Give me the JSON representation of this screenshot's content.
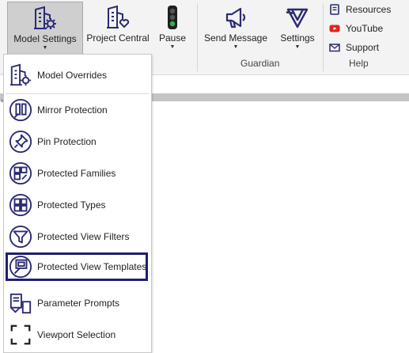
{
  "ribbon": {
    "buttons": [
      {
        "label": "Model Settings",
        "icon": "building-gear-icon",
        "has_dropdown": true
      },
      {
        "label": "Project Central",
        "icon": "building-heart-icon",
        "has_dropdown": false
      },
      {
        "label": "Pause",
        "icon": "traffic-light-icon",
        "has_dropdown": true
      },
      {
        "label": "Send Message",
        "icon": "megaphone-icon",
        "has_dropdown": true
      },
      {
        "label": "Settings",
        "icon": "guardian-logo-icon",
        "has_dropdown": true
      }
    ],
    "groups": {
      "guardian": "Guardian",
      "help": "Help"
    },
    "help_items": [
      {
        "label": "Resources",
        "icon": "book-icon"
      },
      {
        "label": "YouTube",
        "icon": "youtube-icon"
      },
      {
        "label": "Support",
        "icon": "envelope-icon"
      }
    ]
  },
  "menu": {
    "items": [
      {
        "label": "Model Overrides",
        "icon": "building-gear-icon"
      },
      {
        "label": "Mirror Protection",
        "icon": "mirror-icon"
      },
      {
        "label": "Pin Protection",
        "icon": "pin-icon"
      },
      {
        "label": "Protected Families",
        "icon": "families-icon"
      },
      {
        "label": "Protected Types",
        "icon": "types-icon"
      },
      {
        "label": "Protected View Filters",
        "icon": "filter-icon"
      },
      {
        "label": "Protected View Templates",
        "icon": "view-template-icon",
        "highlighted": true
      },
      {
        "label": "Parameter Prompts",
        "icon": "parameter-prompt-icon"
      },
      {
        "label": "Viewport Selection",
        "icon": "viewport-icon"
      }
    ]
  },
  "colors": {
    "icon_navy": "#2b2a72",
    "highlight_border": "#1f1f6e",
    "youtube_red": "#e62117",
    "traffic_green": "#2fb34a"
  }
}
